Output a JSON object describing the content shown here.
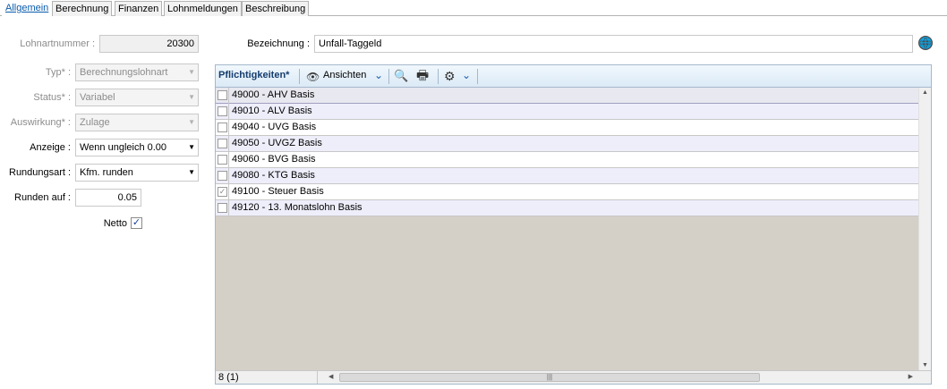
{
  "tabs": [
    "Allgemein",
    "Berechnung",
    "Finanzen",
    "Lohnmeldungen",
    "Beschreibung"
  ],
  "form": {
    "lohnartnummer_label": "Lohnartnummer :",
    "lohnartnummer_value": "20300",
    "typ_label": "Typ* :",
    "typ_value": "Berechnungslohnart",
    "status_label": "Status* :",
    "status_value": "Variabel",
    "auswirkung_label": "Auswirkung* :",
    "auswirkung_value": "Zulage",
    "anzeige_label": "Anzeige :",
    "anzeige_value": "Wenn ungleich 0.00",
    "rundungsart_label": "Rundungsart :",
    "rundungsart_value": "Kfm. runden",
    "runden_auf_label": "Runden auf :",
    "runden_auf_value": "0.05",
    "netto_label": "Netto",
    "netto_checked": "✓",
    "bezeichnung_label": "Bezeichnung :",
    "bezeichnung_value": "Unfall-Taggeld"
  },
  "grid": {
    "title": "Pflichtigkeiten*",
    "ansichten_label": "Ansichten",
    "rows": [
      {
        "text": "49000 - AHV Basis",
        "checked": ""
      },
      {
        "text": "49010 - ALV Basis",
        "checked": ""
      },
      {
        "text": "49040 - UVG Basis",
        "checked": ""
      },
      {
        "text": "49050 - UVGZ Basis",
        "checked": ""
      },
      {
        "text": "49060 - BVG Basis",
        "checked": ""
      },
      {
        "text": "49080 - KTG Basis",
        "checked": ""
      },
      {
        "text": "49100 - Steuer Basis",
        "checked": "✓"
      },
      {
        "text": "49120 - 13. Monatslohn Basis",
        "checked": ""
      }
    ],
    "count": "8 (1)"
  },
  "icons": {
    "dropdown": "▼",
    "eye": "👁",
    "preview": "🔍",
    "print": "🖶",
    "gear": "⚙",
    "chevron": "⌄",
    "globe": "🌐",
    "scroll_up": "▲",
    "scroll_down": "▼",
    "scroll_left": "◀",
    "scroll_right": "▶",
    "grip": "|||"
  }
}
